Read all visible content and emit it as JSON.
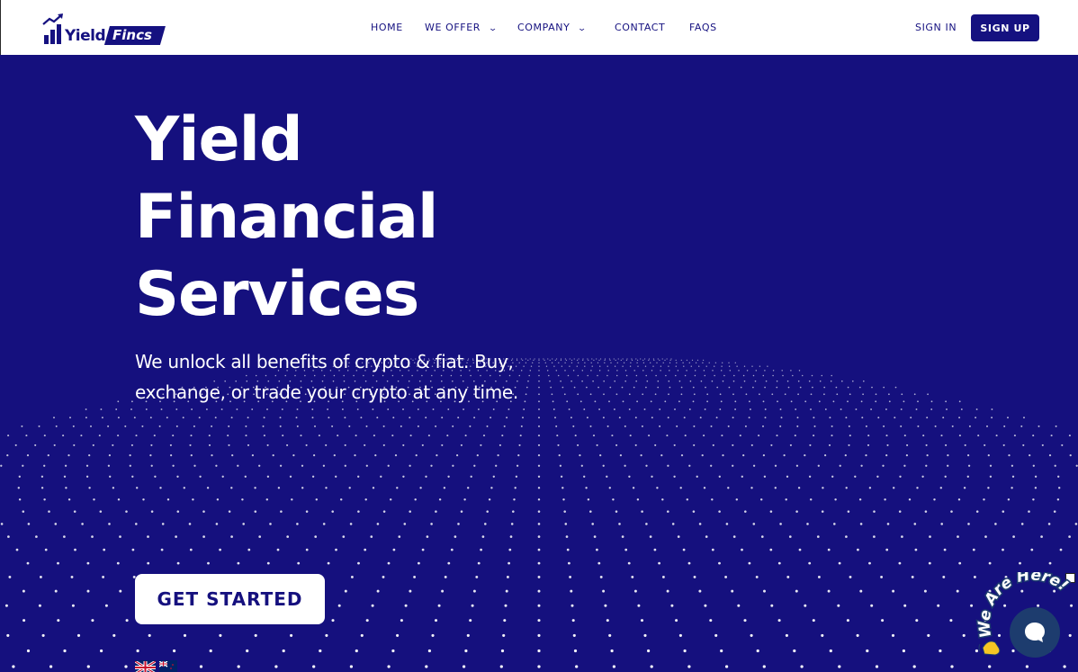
{
  "brand": {
    "name_part1": "Yield",
    "name_part2": "Fincs"
  },
  "nav": {
    "items": [
      {
        "label": "HOME",
        "dropdown": false
      },
      {
        "label": "WE OFFER",
        "dropdown": true
      },
      {
        "label": "COMPANY",
        "dropdown": true
      },
      {
        "label": "CONTACT",
        "dropdown": false
      },
      {
        "label": "FAQS",
        "dropdown": false
      }
    ],
    "signin_label": "SIGN IN",
    "signup_label": "SIGN UP"
  },
  "hero": {
    "title_lines": [
      "Yield",
      "Financial",
      "Services"
    ],
    "subtitle": "We unlock all benefits of crypto & fiat. Buy, exchange, or trade your crypto at any time.",
    "cta_label": "GET STARTED"
  },
  "chat": {
    "badge_text": "We Are Here!"
  },
  "colors": {
    "primary": "#15107e",
    "chat": "#1d3c6e",
    "wave": "#f5c623",
    "white": "#ffffff"
  },
  "icons": [
    "logo-bars-icon",
    "chevron-down-icon",
    "uk-flag-icon",
    "nz-flag-icon",
    "chat-bubble-icon",
    "wave-hand-icon",
    "close-icon"
  ]
}
